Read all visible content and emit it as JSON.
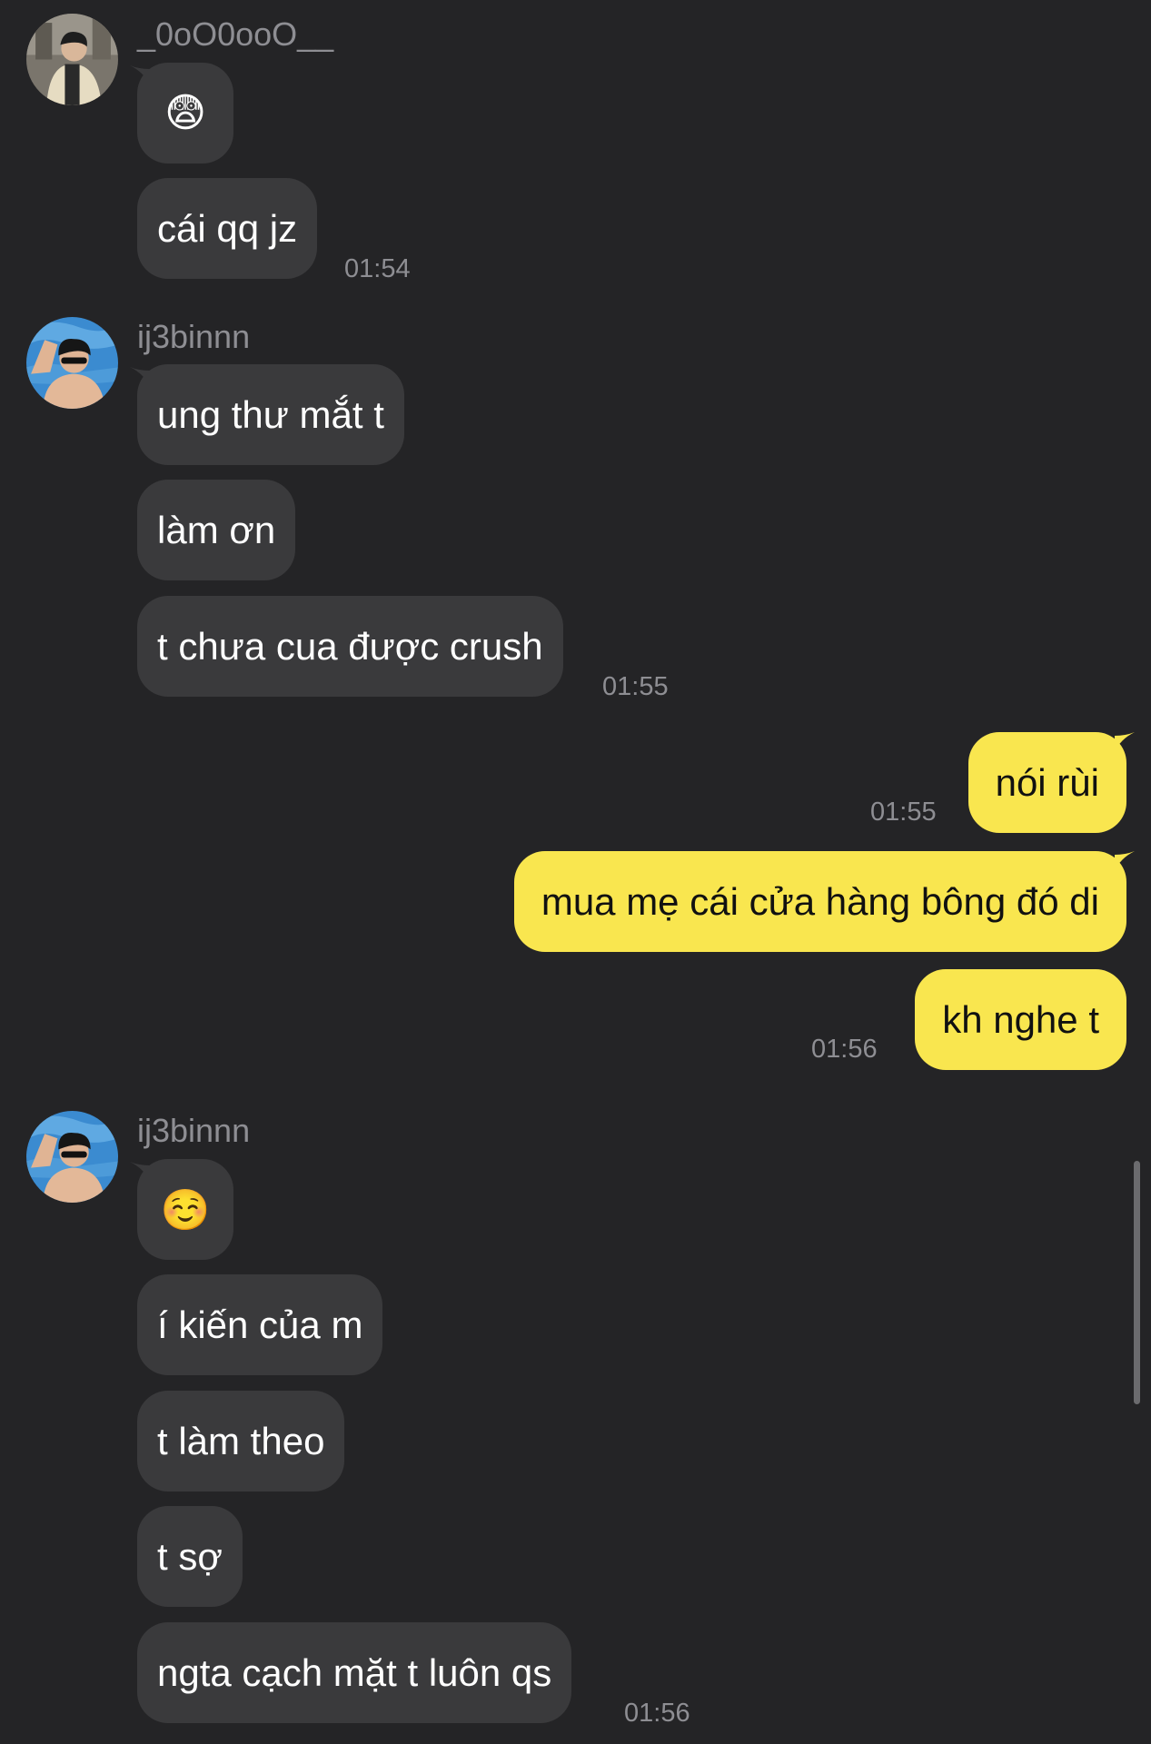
{
  "messages": {
    "group1": {
      "sender": "_0oO0ooO__",
      "m1": "😨",
      "m2": "cái qq jz",
      "time": "01:54"
    },
    "group2": {
      "sender": "ij3binnn",
      "m1": "ung thư mắt t",
      "m2": "làm ơn",
      "m3": "t chưa cua được crush",
      "time": "01:55"
    },
    "mine1": {
      "m1": "nói rùi",
      "time1": "01:55",
      "m2": "mua mẹ cái cửa hàng bông đó di",
      "m3": "kh nghe t",
      "time2": "01:56"
    },
    "group3": {
      "sender": "ij3binnn",
      "m1": "☺️",
      "m2": "í kiến của m",
      "m3": "t làm theo",
      "m4": "t sợ",
      "m5": "ngta cạch mặt t luôn qs",
      "time": "01:56"
    }
  },
  "colors": {
    "background": "#242426",
    "incoming_bubble": "#3a3a3c",
    "outgoing_bubble": "#f9e64f",
    "timestamp": "#8e8e93"
  }
}
